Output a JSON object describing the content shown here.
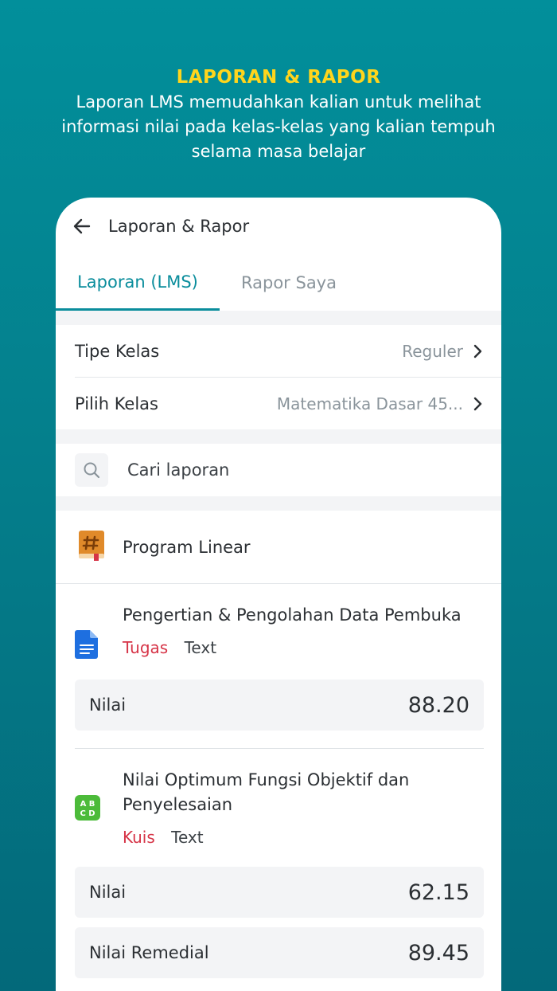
{
  "promo": {
    "title": "LAPORAN & RAPOR",
    "description": "Laporan LMS memudahkan kalian untuk melihat informasi nilai pada kelas-kelas yang kalian tempuh selama masa belajar"
  },
  "appbar": {
    "title": "Laporan & Rapor",
    "back_icon": "arrow-left-icon"
  },
  "tabs": [
    {
      "label": "Laporan (LMS)",
      "active": true
    },
    {
      "label": "Rapor Saya",
      "active": false
    }
  ],
  "filters": {
    "tipe_kelas": {
      "label": "Tipe Kelas",
      "value": "Reguler"
    },
    "pilih_kelas": {
      "label": "Pilih Kelas",
      "value": "Matematika Dasar 45..."
    }
  },
  "search": {
    "placeholder": "Cari laporan"
  },
  "topic": {
    "title": "Program Linear",
    "icon": "hashtag-book-icon"
  },
  "items": [
    {
      "title": "Pengertian & Pengolahan Data Pembuka",
      "tag": "Tugas",
      "type": "Text",
      "icon": "document-icon",
      "scores": [
        {
          "label": "Nilai",
          "value": "88.20"
        }
      ]
    },
    {
      "title": "Nilai Optimum Fungsi Objektif dan Penyelesaian",
      "tag": "Kuis",
      "type": "Text",
      "icon": "quiz-abcd-icon",
      "scores": [
        {
          "label": "Nilai",
          "value": "62.15"
        },
        {
          "label": "Nilai Remedial",
          "value": "89.45"
        }
      ]
    }
  ],
  "colors": {
    "accent": "#0a8d9c",
    "promo_title": "#ffd51c",
    "tag": "#d63447",
    "background_top": "#028f9b",
    "background_bottom": "#03697a"
  }
}
